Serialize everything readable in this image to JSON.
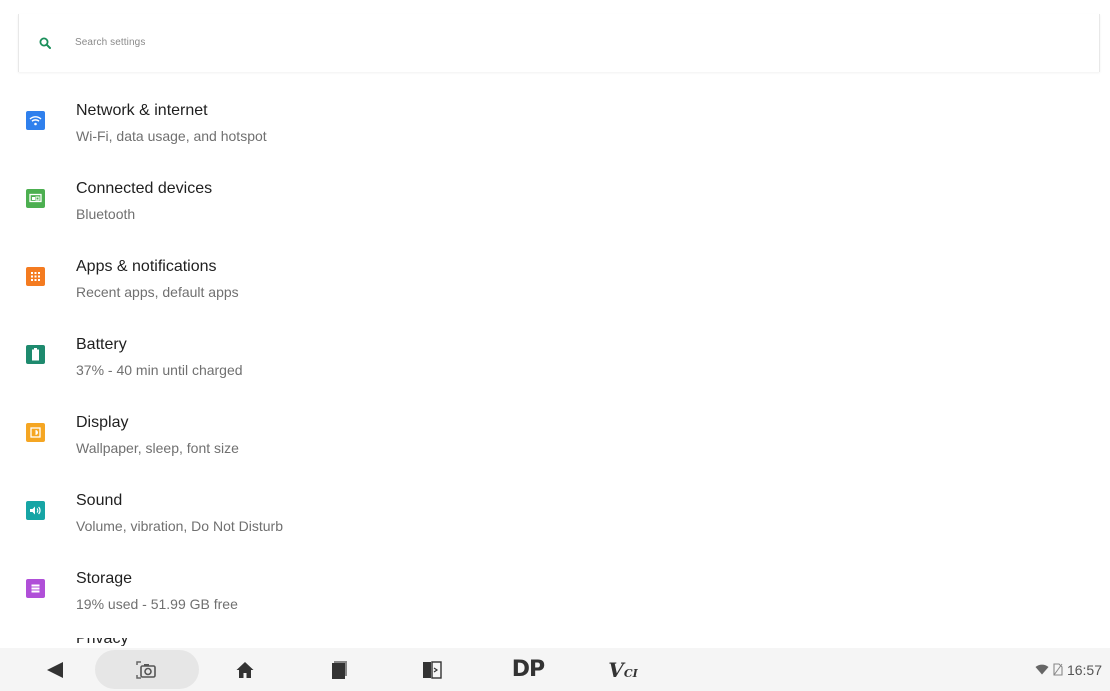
{
  "search": {
    "placeholder": "Search settings"
  },
  "settings": {
    "items": [
      {
        "title": "Network & internet",
        "summary": "Wi-Fi, data usage, and hotspot",
        "icon": "wifi-icon",
        "color": "#2f80ed"
      },
      {
        "title": "Connected devices",
        "summary": "Bluetooth",
        "icon": "connected-devices-icon",
        "color": "#4caf50"
      },
      {
        "title": "Apps & notifications",
        "summary": "Recent apps, default apps",
        "icon": "apps-icon",
        "color": "#f47b20"
      },
      {
        "title": "Battery",
        "summary": "37% - 40 min until charged",
        "icon": "battery-icon",
        "color": "#1e8a6e"
      },
      {
        "title": "Display",
        "summary": "Wallpaper, sleep, font size",
        "icon": "display-icon",
        "color": "#f5a623"
      },
      {
        "title": "Sound",
        "summary": "Volume, vibration, Do Not Disturb",
        "icon": "sound-icon",
        "color": "#16a5a5"
      },
      {
        "title": "Storage",
        "summary": "19% used - 51.99 GB free",
        "icon": "storage-icon",
        "color": "#b04fd8"
      }
    ],
    "partial_next_title": "Privacy"
  },
  "navbar": {
    "dp_label": "DP",
    "vci_label": "V",
    "vci_sub": "CI",
    "buttons": [
      "back-icon",
      "screenshot-icon",
      "home-icon",
      "recents-icon",
      "split-screen-icon"
    ]
  },
  "status": {
    "time": "16:57",
    "icons": [
      "wifi-status-icon",
      "no-sim-icon"
    ]
  },
  "colors": {
    "search_accent": "#1a8f5a",
    "nav_background": "#f5f5f5",
    "nav_icon": "#333333"
  }
}
